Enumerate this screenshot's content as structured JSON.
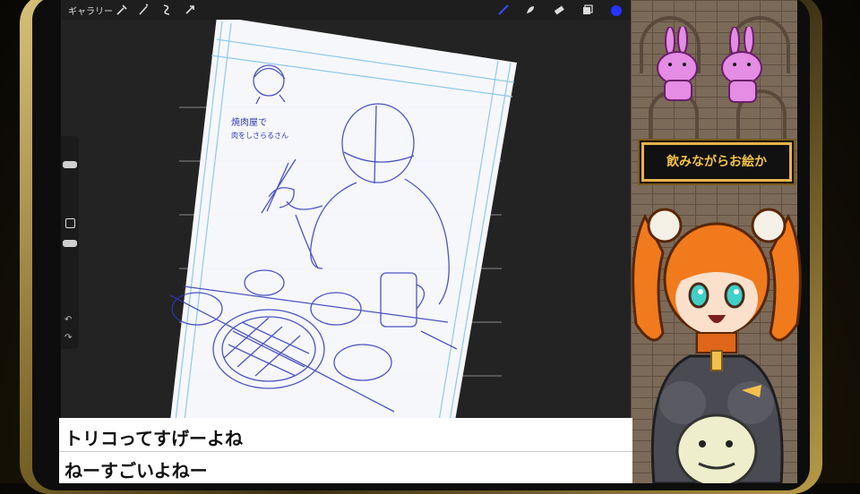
{
  "toolbar": {
    "gallery_label": "ギャラリー",
    "left_tools": [
      "wrench-icon",
      "magic-wand-icon",
      "selection-icon",
      "transform-icon"
    ],
    "right_tools": [
      "brush-icon",
      "smudge-icon",
      "eraser-icon",
      "layers-icon",
      "color-icon"
    ],
    "accent_color": "#2533ff"
  },
  "sketch": {
    "note_line1": "焼肉屋で",
    "note_line2": "肉をしさらるさん"
  },
  "stream": {
    "title": "飲みながらお絵か"
  },
  "subtitles": [
    "トリコってすげーよね",
    "ねーすごいよねー"
  ]
}
